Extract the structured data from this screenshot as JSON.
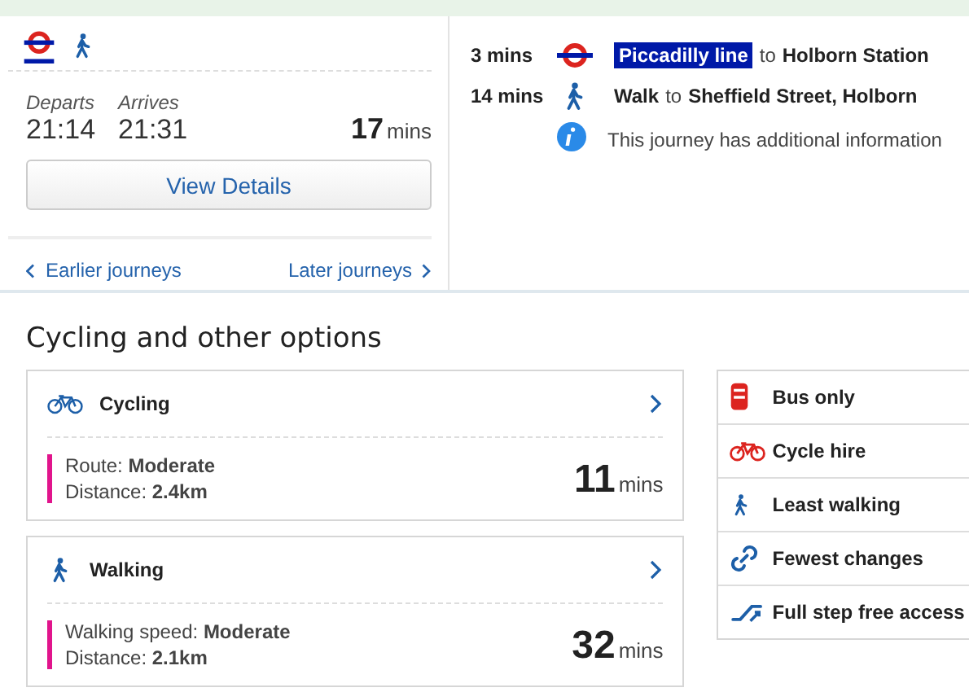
{
  "journey": {
    "modes": [
      {
        "kind": "tube"
      },
      {
        "kind": "walk"
      }
    ],
    "departs_label": "Departs",
    "departs": "21:14",
    "arrives_label": "Arrives",
    "arrives": "21:31",
    "duration": "17",
    "duration_unit": "mins",
    "details_button": "View Details",
    "earlier": "Earlier journeys",
    "later": "Later journeys"
  },
  "legs": [
    {
      "kind": "tube",
      "time": "3 mins",
      "mode": "Piccadilly line",
      "to": "to",
      "destination": "Holborn Station"
    },
    {
      "kind": "walk",
      "time": "14 mins",
      "mode": "Walk",
      "to": "to",
      "destination": "Sheffield Street, Holborn"
    }
  ],
  "info": "This journey has additional information",
  "section_title": "Cycling and other options",
  "options": [
    {
      "kind": "cycle",
      "title": "Cycling",
      "lines": [
        "Route: **Moderate**",
        "Distance: **2.4km**"
      ],
      "duration": "11",
      "unit": "mins"
    },
    {
      "kind": "walk",
      "title": "Walking",
      "lines": [
        "Walking speed: **Moderate**",
        "Distance: **2.1km**"
      ],
      "duration": "32",
      "unit": "mins"
    }
  ],
  "filters": [
    {
      "kind": "bus",
      "label": "Bus only"
    },
    {
      "kind": "cycle",
      "label": "Cycle hire"
    },
    {
      "kind": "walk",
      "label": "Least walking"
    },
    {
      "kind": "changes",
      "label": "Fewest changes"
    },
    {
      "kind": "stepfree",
      "label": "Full step free access"
    }
  ]
}
